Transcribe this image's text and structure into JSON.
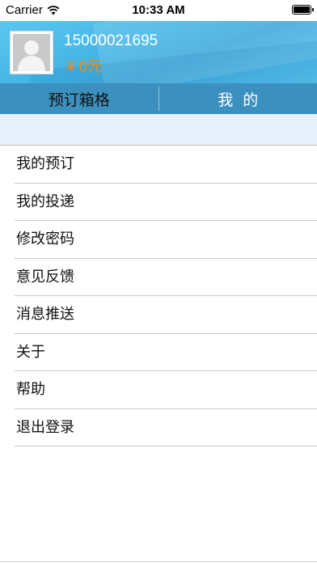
{
  "status_bar": {
    "carrier": "Carrier",
    "time": "10:33 AM"
  },
  "profile": {
    "phone": "15000021695",
    "balance": "￥0元"
  },
  "tabs": [
    {
      "label": "预订箱格",
      "active": false
    },
    {
      "label": "我  的",
      "active": true
    }
  ],
  "menu": {
    "items": [
      {
        "label": "我的预订"
      },
      {
        "label": "我的投递"
      },
      {
        "label": "修改密码"
      },
      {
        "label": "意见反馈"
      },
      {
        "label": "消息推送"
      },
      {
        "label": "关于"
      },
      {
        "label": "帮助"
      },
      {
        "label": "退出登录"
      }
    ]
  },
  "colors": {
    "header": "#4fb8e8",
    "tab_bar": "#3c90c0",
    "balance": "#f08a1c",
    "strip": "#e8f1fb"
  },
  "icons": {
    "wifi": "wifi-icon",
    "battery": "battery-icon",
    "avatar": "default-user-avatar"
  }
}
